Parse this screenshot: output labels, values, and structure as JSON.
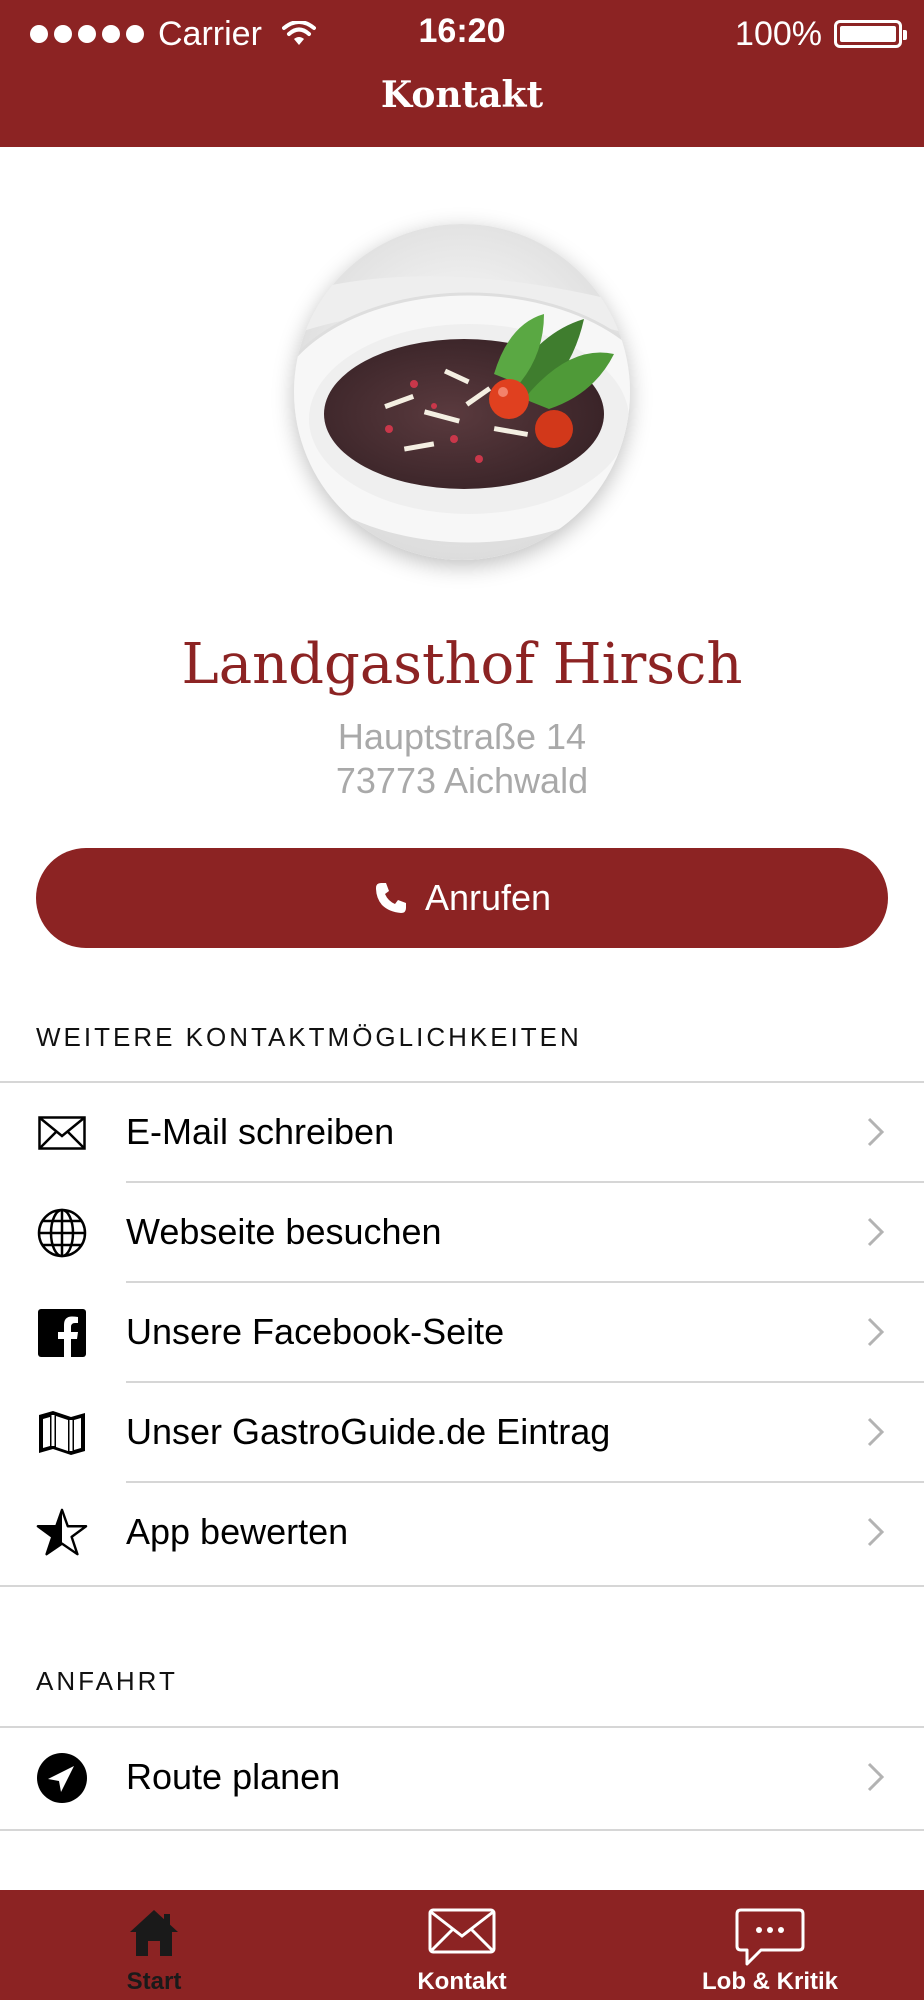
{
  "status_bar": {
    "carrier": "Carrier",
    "time": "16:20",
    "battery": "100%"
  },
  "nav": {
    "title": "Kontakt"
  },
  "restaurant": {
    "name": "Landgasthof Hirsch",
    "street": "Hauptstraße 14",
    "city": "73773 Aichwald"
  },
  "call_button": {
    "label": "Anrufen"
  },
  "contact_section": {
    "header": "WEITERE KONTAKTMÖGLICHKEITEN",
    "items": [
      {
        "label": "E-Mail schreiben",
        "icon": "mail-icon"
      },
      {
        "label": "Webseite besuchen",
        "icon": "globe-icon"
      },
      {
        "label": "Unsere Facebook-Seite",
        "icon": "facebook-icon"
      },
      {
        "label": "Unser GastroGuide.de Eintrag",
        "icon": "map-icon"
      },
      {
        "label": "App bewerten",
        "icon": "star-icon"
      }
    ]
  },
  "directions_section": {
    "header": "ANFAHRT",
    "items": [
      {
        "label": "Route planen",
        "icon": "location-arrow-icon"
      }
    ]
  },
  "tab_bar": {
    "tabs": [
      {
        "label": "Start",
        "icon": "home-icon",
        "active": true
      },
      {
        "label": "Kontakt",
        "icon": "mail-icon",
        "active": false
      },
      {
        "label": "Lob & Kritik",
        "icon": "chat-bubble-icon",
        "active": false
      }
    ]
  },
  "colors": {
    "brand": "#8c2323",
    "address_gray": "#a9a9a9",
    "divider": "#d6d6d6"
  }
}
